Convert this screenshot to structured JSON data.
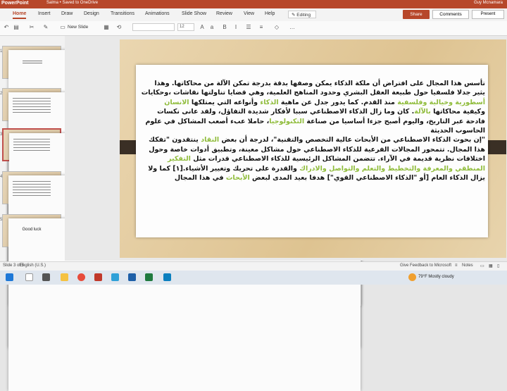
{
  "titlebar": {
    "app": "PowerPoint",
    "doc": "Salma • Saved to OneDrive",
    "user": "Guy Mcnamara"
  },
  "tabs": [
    "Home",
    "Insert",
    "Draw",
    "Design",
    "Transitions",
    "Animations",
    "Slide Show",
    "Review",
    "View",
    "Help"
  ],
  "editing": "Editing",
  "share": "Share",
  "comments": "Comments",
  "present": "Present",
  "ribbon": {
    "new_slide": "New Slide",
    "font_size": "12"
  },
  "thumbs": [
    {
      "num": "1",
      "label": ""
    },
    {
      "num": "2",
      "label": ""
    },
    {
      "num": "3",
      "label": ""
    },
    {
      "num": "4",
      "label": ""
    },
    {
      "num": "5",
      "label": "Good luck"
    }
  ],
  "slide_text": {
    "p1": "تأسس هذا المجال على افتراض أن ملكة الذكاء يمكن وصفها بدقة بدرجة تمكن الآلة من محاكاتها. وهذا يثير جدلا فلسفيا حول طبيعة العقل البشري وحدود المناهج العلمية، وهي قضايا تناولتها نقاشات",
    "p2a": "،وحكايات ",
    "p2h1": "أسطورية وخيالية وفلسفية",
    "p2b": " منذ القدم. كما يدور جدل عن ماهية ",
    "p2h2": "الذكاء",
    "p2c": " وأنواعه التي يمتلكها ",
    "p2h3": "الانسان",
    "p3a": "وكيفية محاكاتها ",
    "p3h1": "بالآلة",
    "p3b": ". كان وما زال الذكاء الاصطناعي سببا لأفكار شديدة التفاؤل، ولقد عانى نكسات فادحة عبر التاريخ، واليوم أصبح جزءا أساسيا من صناعة ",
    "p3h2": "التكنولوجيا",
    "p3c": "، حاملا عبء أصعب المشاكل في علوم الحاسوب الحديثة",
    "p4a": "\"إن بحوث الذكاء الاصطناعي من الأبحاث عالية التخصص والتقنية\"، لدرجة أن بعض ",
    "p4h1": "النقاد",
    "p4b": " ينتقدون \"تفكك هذا المجال. تتمحور المجالات الفرعية للذكاء الاصطناعي حول مشاكل معينة، وتطبيق أدوات خاصة وحول اختلافات نظرية قديمة في الآراء. تتضمن المشاكل الرئيسية للذكاء الاصطناعي قدرات مثل ",
    "p4h2": "التفكير المنطقي والمعرفة والتخطيط والتعلم والتواصل والادراك",
    "p4c": " والقدرة على تحريك وتغيير الأشياء.",
    "p4d": "[١] كما ولا يزال الذكاء العام [أو \"الذكاء الاصطناعي القوي\"] هدفا بعيد المدى لبعض ",
    "p4h3": "الأبحاث",
    "p4e": " في هذا المجال"
  },
  "status": {
    "slide": "Slide 3 of 5",
    "lang": "English (U.S.)",
    "feedback": "Give Feedback to Microsoft",
    "notes": "Notes"
  },
  "taskbar": {
    "weather": "79°F  Mostly cloudy"
  }
}
